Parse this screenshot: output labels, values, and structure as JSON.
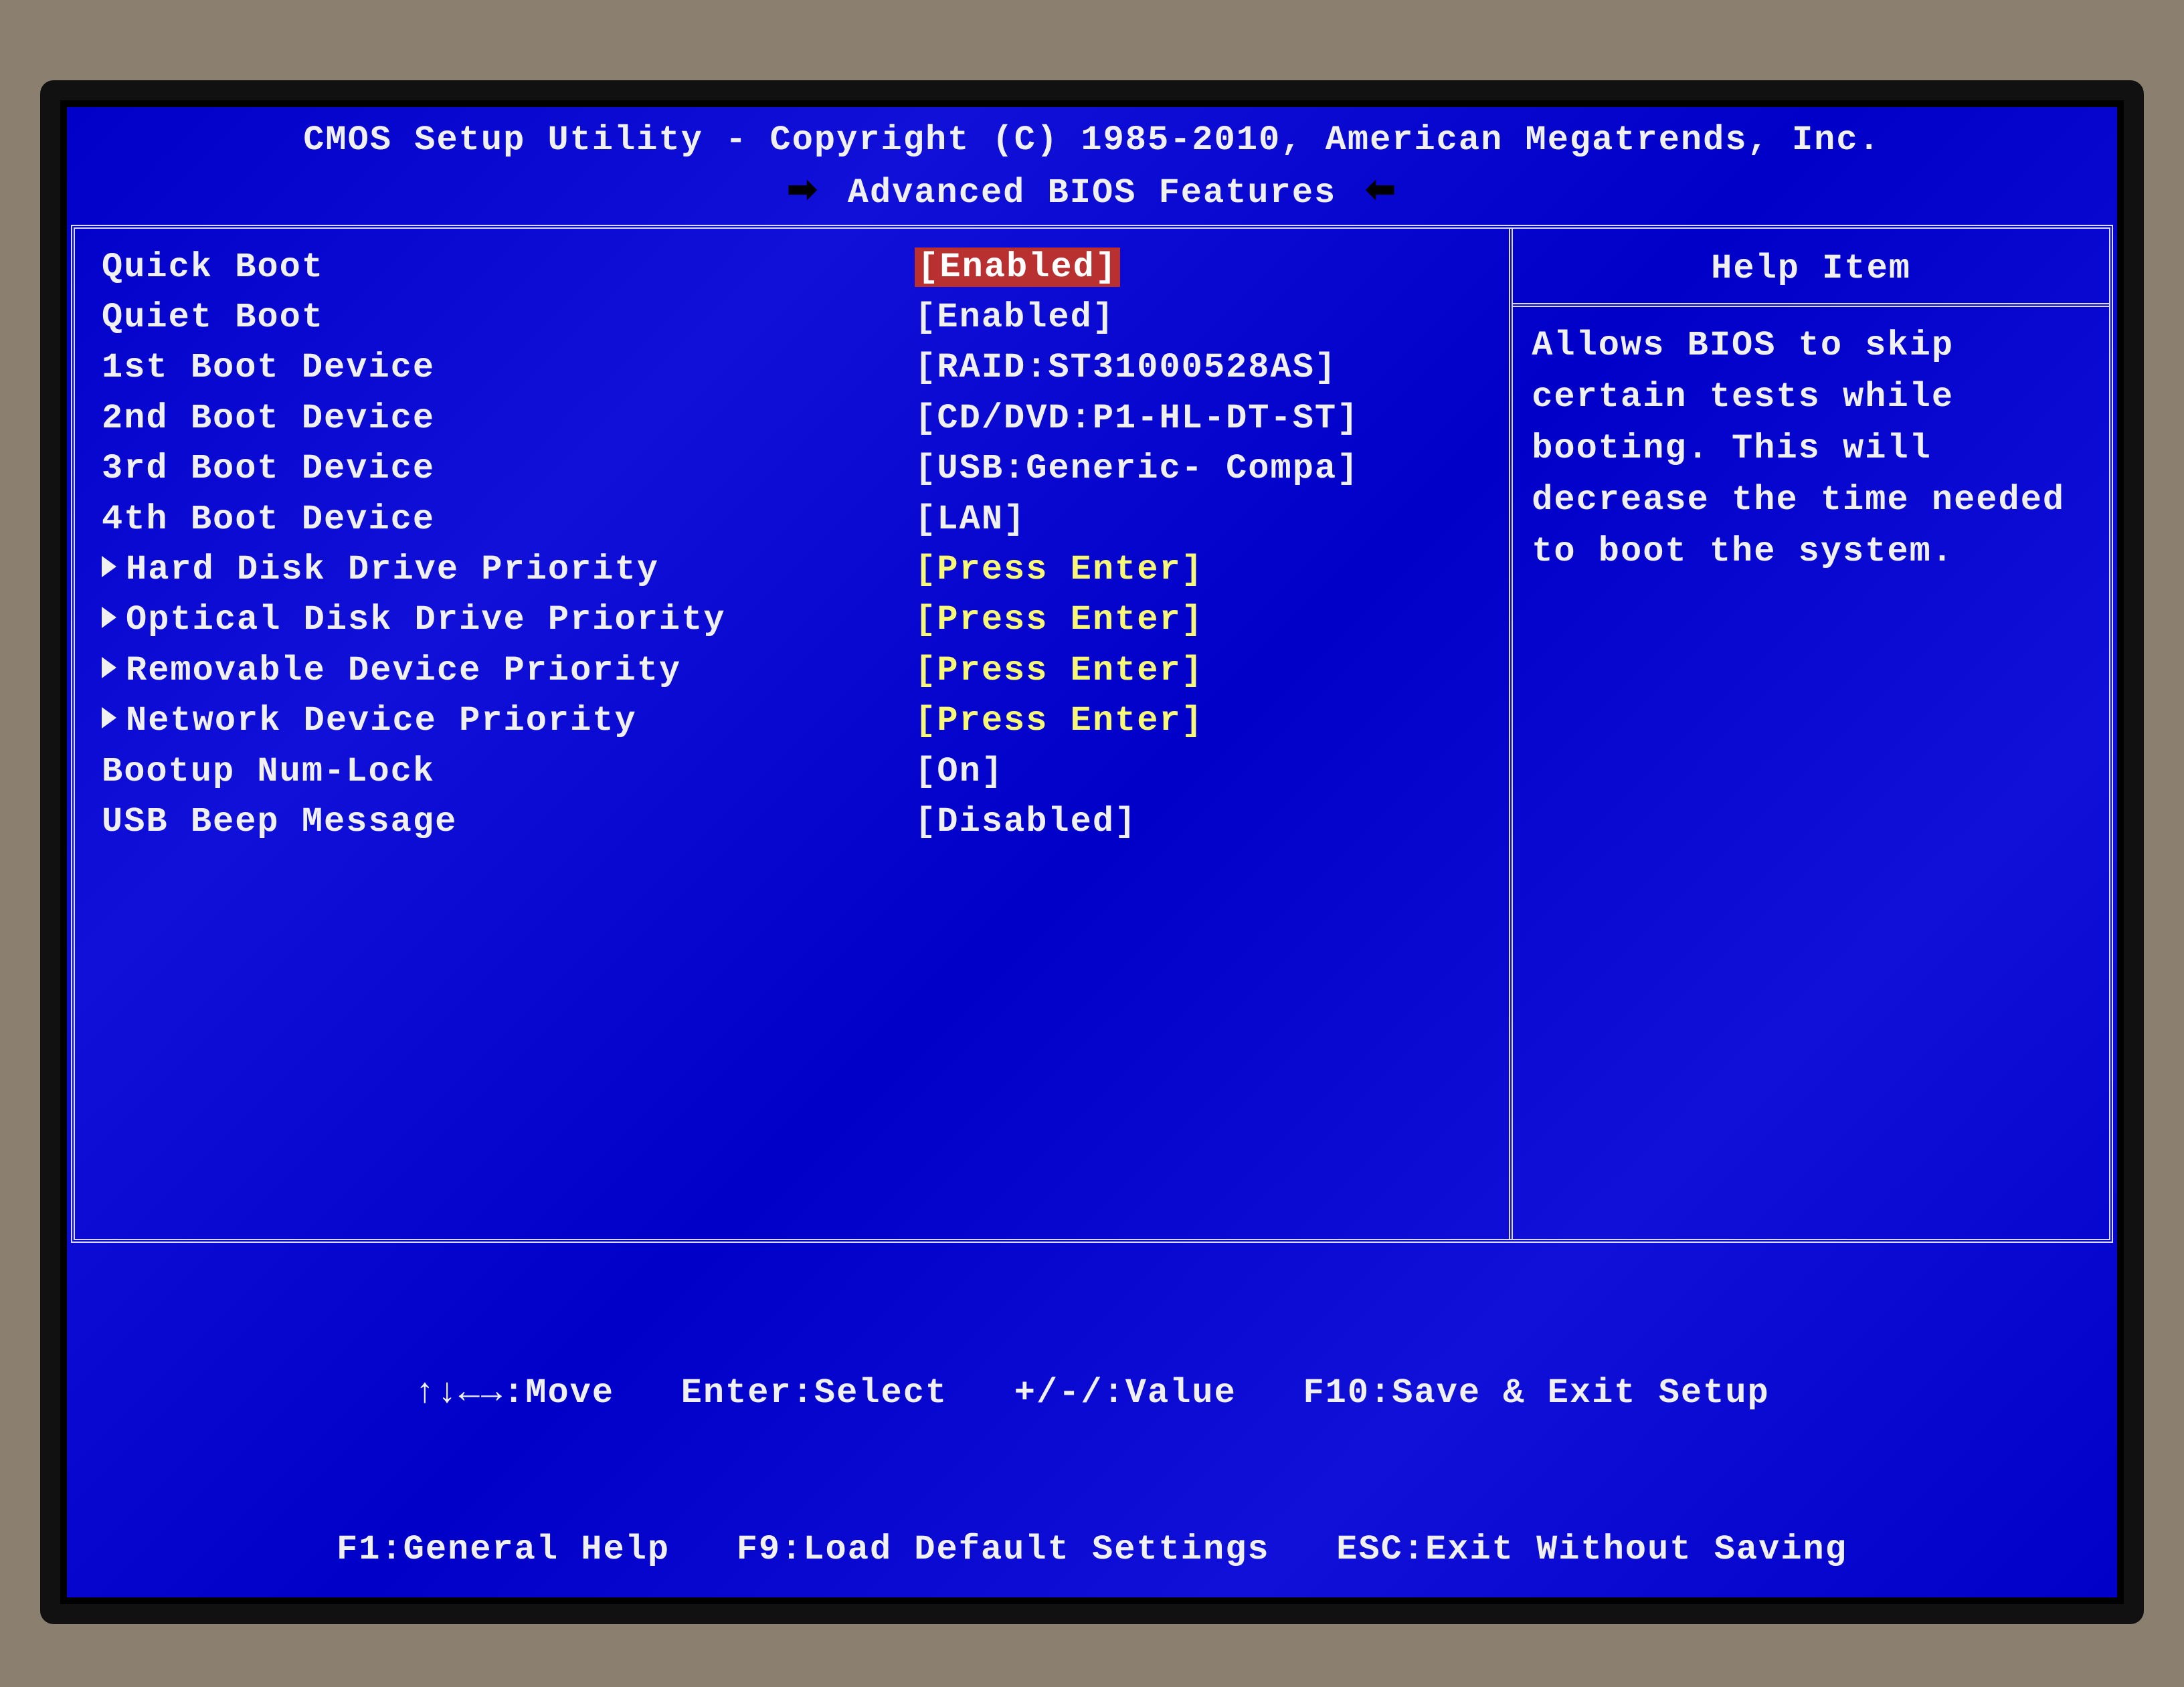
{
  "header": {
    "title": "CMOS Setup Utility - Copyright (C) 1985-2010, American Megatrends, Inc.",
    "subtitle": "Advanced BIOS Features"
  },
  "settings": [
    {
      "label": "Quick Boot",
      "value": "[Enabled]",
      "submenu": false,
      "yellow": false,
      "selected": true
    },
    {
      "label": "Quiet Boot",
      "value": "[Enabled]",
      "submenu": false,
      "yellow": false,
      "selected": false
    },
    {
      "label": "1st Boot Device",
      "value": "[RAID:ST31000528AS]",
      "submenu": false,
      "yellow": false,
      "selected": false
    },
    {
      "label": "2nd Boot Device",
      "value": "[CD/DVD:P1-HL-DT-ST]",
      "submenu": false,
      "yellow": false,
      "selected": false
    },
    {
      "label": "3rd Boot Device",
      "value": "[USB:Generic- Compa]",
      "submenu": false,
      "yellow": false,
      "selected": false
    },
    {
      "label": "4th Boot Device",
      "value": "[LAN]",
      "submenu": false,
      "yellow": false,
      "selected": false
    },
    {
      "label": "Hard Disk Drive Priority",
      "value": "[Press Enter]",
      "submenu": true,
      "yellow": true,
      "selected": false
    },
    {
      "label": "Optical Disk Drive Priority",
      "value": "[Press Enter]",
      "submenu": true,
      "yellow": true,
      "selected": false
    },
    {
      "label": "Removable Device Priority",
      "value": "[Press Enter]",
      "submenu": true,
      "yellow": true,
      "selected": false
    },
    {
      "label": "Network Device Priority",
      "value": "[Press Enter]",
      "submenu": true,
      "yellow": true,
      "selected": false
    },
    {
      "label": "Bootup Num-Lock",
      "value": "[On]",
      "submenu": false,
      "yellow": false,
      "selected": false
    },
    {
      "label": "USB Beep Message",
      "value": "[Disabled]",
      "submenu": false,
      "yellow": false,
      "selected": false
    }
  ],
  "help": {
    "title": "Help Item",
    "body": "Allows BIOS to skip certain tests while booting. This will decrease the time needed to boot the system."
  },
  "footer": {
    "line1": "↑↓←→:Move   Enter:Select   +/-/:Value   F10:Save & Exit Setup",
    "line2": "F1:General Help   F9:Load Default Settings   ESC:Exit Without Saving"
  }
}
